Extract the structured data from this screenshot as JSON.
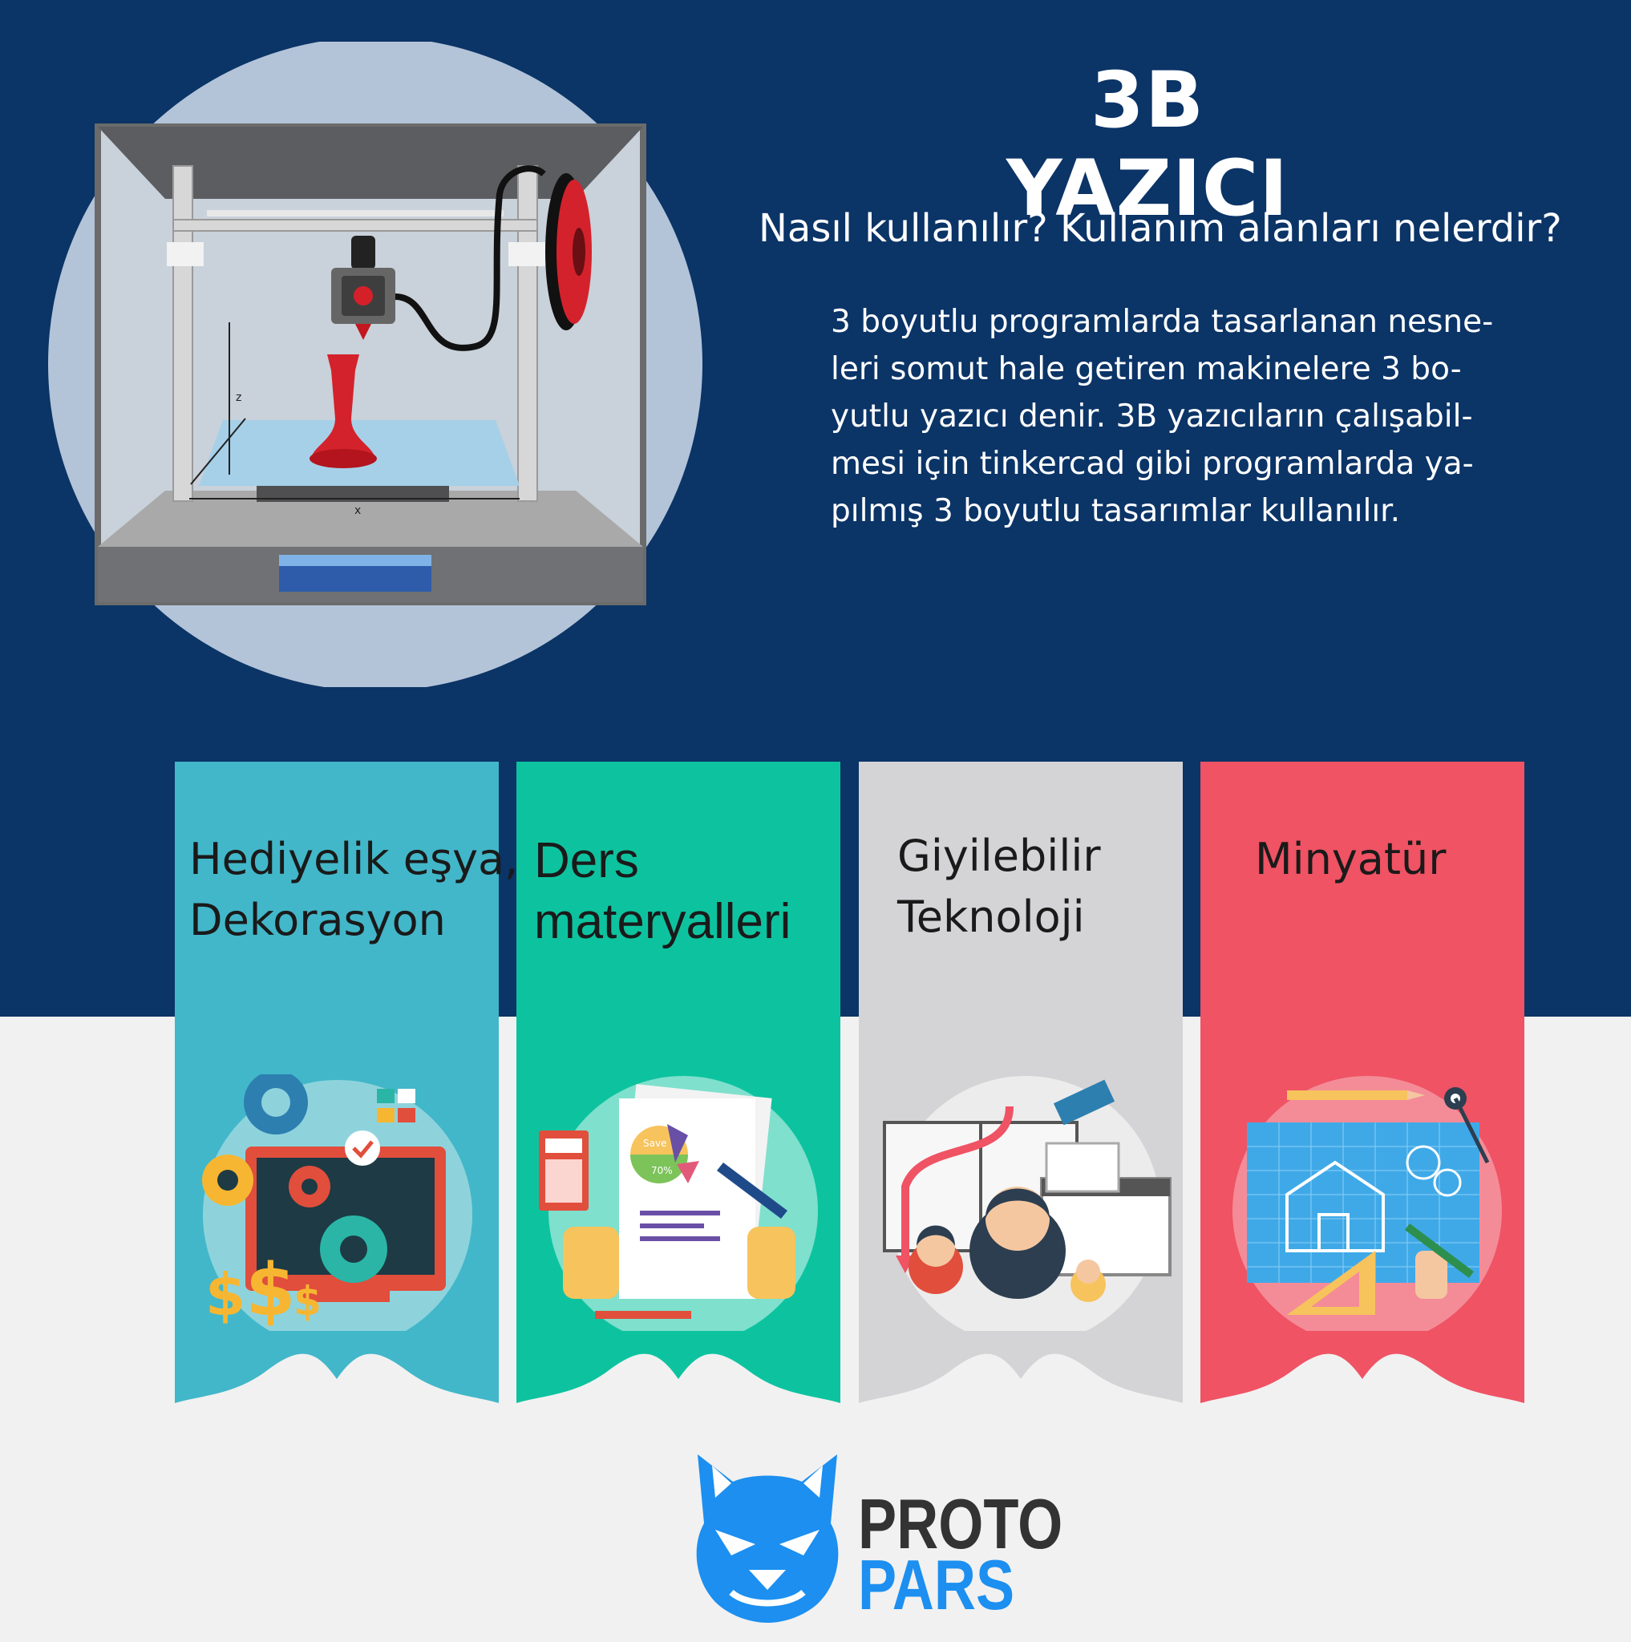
{
  "header": {
    "title": "3B YAZICI",
    "subtitle": "Nasıl kullanılır? Kullanım alanları nelerdir?"
  },
  "description": {
    "lines": [
      "3 boyutlu programlarda tasarlanan nesne-",
      "leri somut hale getiren makinelere 3 bo-",
      "yutlu yazıcı denir.  3B yazıcıların çalışabil-",
      "mesi için tinkercad gibi programlarda ya-",
      "pılmış 3 boyutlu tasarımlar kullanılır."
    ]
  },
  "printer_illustration": {
    "axis_labels": {
      "z": "z",
      "x": "x"
    }
  },
  "usage_areas": [
    {
      "title_lines": [
        "Hediyelik eşya,",
        "Dekorasyon"
      ],
      "color": "#42b7c9",
      "icon": "gears-computer-money-icon"
    },
    {
      "title_lines": [
        "Ders",
        "materyalleri"
      ],
      "color": "#0dc39f",
      "icon": "report-chart-calculator-icon"
    },
    {
      "title_lines": [
        "Giyilebilir",
        "Teknoloji"
      ],
      "color": "#d4d4d6",
      "icon": "people-book-calendar-icon"
    },
    {
      "title_lines": [
        "Minyatür"
      ],
      "color": "#ef5364",
      "icon": "blueprint-drafting-tools-icon"
    }
  ],
  "icon_labels": {
    "save": "Save",
    "percent": "70%"
  },
  "logo": {
    "line1": "PROTO",
    "line2": "PARS",
    "colors": {
      "blue": "#1c8ff0",
      "dark": "#333333"
    }
  },
  "colors": {
    "navy": "#0b3467",
    "light_gray": "#f1f1f1"
  }
}
